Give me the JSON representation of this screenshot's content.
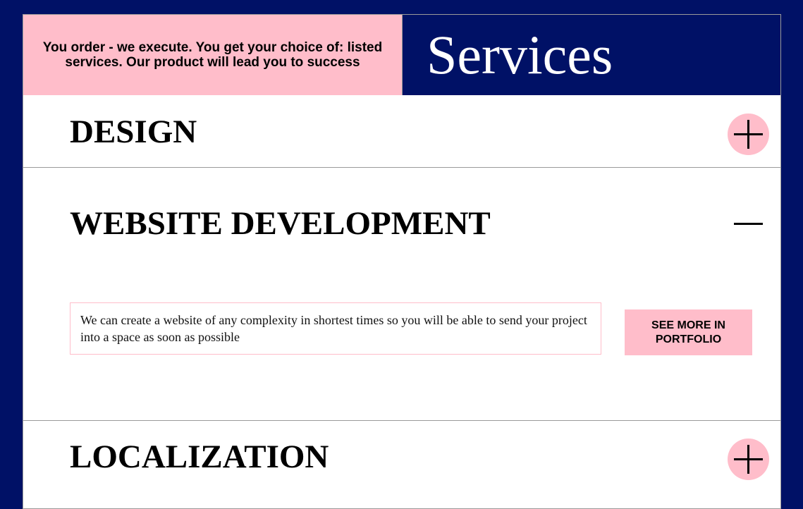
{
  "header": {
    "tagline": "You order - we execute. You get your choice of: listed services. Our product will lead you to success",
    "title": "Services"
  },
  "services": [
    {
      "title": "DESIGN",
      "expanded": false,
      "toggle_icon": "plus-icon"
    },
    {
      "title": "WEBSITE DEVELOPMENT",
      "expanded": true,
      "toggle_icon": "minus-icon",
      "description": "We can create a website of any complexity in shortest times so you will be able to send your project into a space as soon as possible",
      "button_label": "SEE MORE IN PORTFOLIO"
    },
    {
      "title": "LOCALIZATION",
      "expanded": false,
      "toggle_icon": "plus-icon"
    }
  ],
  "colors": {
    "background": "#001166",
    "accent_pink": "#ffbdca",
    "panel": "#ffffff"
  }
}
